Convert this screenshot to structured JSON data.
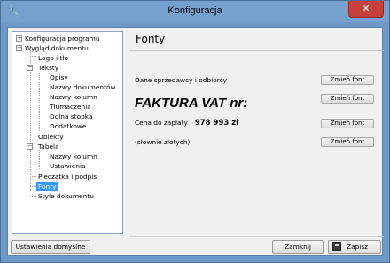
{
  "window": {
    "title": "Konfiguracja",
    "app_icon": "wrench-icon",
    "close_icon": "close-icon",
    "close_glyph": "✕"
  },
  "tree": {
    "items": [
      {
        "label": "Konfiguracja programu",
        "level": 0,
        "expander": "+"
      },
      {
        "label": "Wygląd dokumentu",
        "level": 0,
        "expander": "−"
      },
      {
        "label": "Logo i tło",
        "level": 1
      },
      {
        "label": "Teksty",
        "level": 1,
        "expander": "−"
      },
      {
        "label": "Opisy",
        "level": 2
      },
      {
        "label": "Nazwy dokumentów",
        "level": 2
      },
      {
        "label": "Nazwy kolumn",
        "level": 2
      },
      {
        "label": "Tłumaczenia",
        "level": 2
      },
      {
        "label": "Dolna stopka",
        "level": 2
      },
      {
        "label": "Dodatkowe",
        "level": 2
      },
      {
        "label": "Obiekty",
        "level": 1
      },
      {
        "label": "Tabela",
        "level": 1,
        "expander": "−"
      },
      {
        "label": "Nazwy kolumn",
        "level": 2
      },
      {
        "label": "Ustawienia",
        "level": 2
      },
      {
        "label": "Pieczątka i podpis",
        "level": 1
      },
      {
        "label": "Fonty",
        "level": 1,
        "selected": true
      },
      {
        "label": "Style dokumentu",
        "level": 1
      }
    ]
  },
  "panel": {
    "title": "Fonty",
    "rows": [
      {
        "label": "Dane sprzedawcy i odbiorcy",
        "button": "Zmień font"
      },
      {
        "label": "FAKTURA VAT nr:",
        "button": "Zmień font"
      },
      {
        "label": "Cena do zapłaty",
        "value": "978 993 zł",
        "button": "Zmień font"
      },
      {
        "label": "(słownie złotych)",
        "button": "Zmień font"
      }
    ]
  },
  "footer": {
    "defaults_label": "Ustawienia domyślne",
    "close_label": "Zamknij",
    "save_label": "Zapisz",
    "save_icon": "floppy-disk-icon"
  },
  "colors": {
    "title_bar": "#76a1cf",
    "close_button": "#c7413a",
    "selection": "#3399ff",
    "client_bg": "#f0f0f0"
  }
}
